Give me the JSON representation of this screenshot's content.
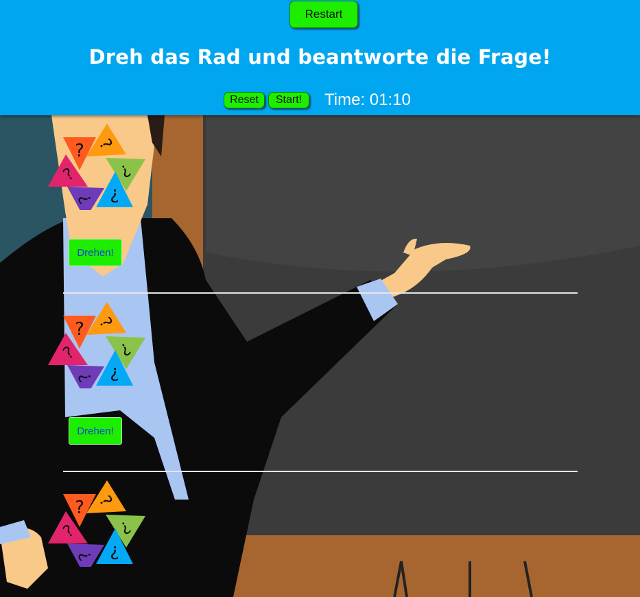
{
  "header": {
    "restart_label": "Restart",
    "title": "Dreh das Rad und beantworte die Frage!",
    "reset_label": "Reset",
    "start_label": "Start!",
    "timer_label": "Time:",
    "timer_value": "01:10"
  },
  "rounds": [
    {
      "wheel_icon": "question-mark-triangle-wheel",
      "spin_label": "Drehen!"
    },
    {
      "wheel_icon": "question-mark-triangle-wheel",
      "spin_label": "Drehen!"
    },
    {
      "wheel_icon": "question-mark-triangle-wheel"
    }
  ],
  "wheel_colors": [
    "#ff5b1e",
    "#ff9a10",
    "#e2246d",
    "#8bc34a",
    "#6e3bb9",
    "#03a9f4"
  ],
  "colors": {
    "header_bg": "#00a6f0",
    "button_green": "#1dee00",
    "board": "#3b3b3b",
    "board_frame": "#a7662f",
    "shirt": "#a9c6f2",
    "skin": "#f9c98a"
  }
}
